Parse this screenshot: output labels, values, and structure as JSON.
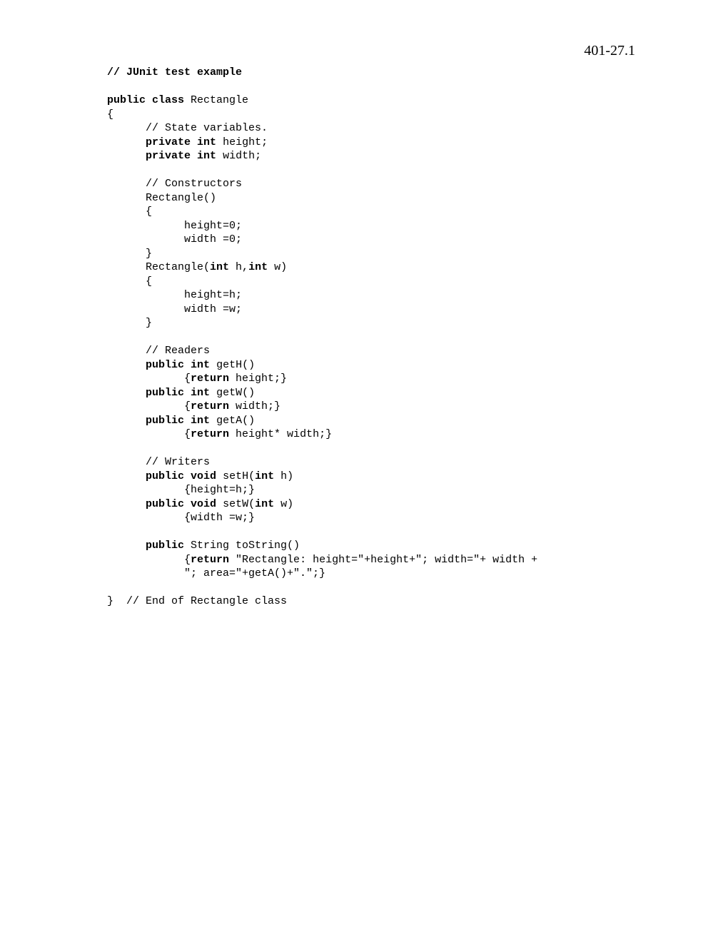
{
  "pageNumber": "401-27.1",
  "code": {
    "l1": "// JUnit test example",
    "l2a": "public",
    "l2b": "class",
    "l2c": " Rectangle",
    "l3": "{",
    "l4": "      // State variables.",
    "l5a": "private",
    "l5b": "int",
    "l5c": " height;",
    "l6a": "private",
    "l6b": "int",
    "l6c": " width;",
    "l7": "      // Constructors",
    "l8": "      Rectangle()",
    "l9": "      {",
    "l10": "            height=0;",
    "l11": "            width =0;",
    "l12": "      }",
    "l13a": "      Rectangle(",
    "l13b": "int",
    "l13c": " h,",
    "l13d": "int",
    "l13e": " w)",
    "l14": "      {",
    "l15": "            height=h;",
    "l16": "            width =w;",
    "l17": "      }",
    "l18": "      // Readers",
    "l19a": "public",
    "l19b": "int",
    "l19c": " getH()",
    "l20a": "            {",
    "l20b": "return",
    "l20c": " height;}",
    "l21a": "public",
    "l21b": "int",
    "l21c": " getW()",
    "l22a": "            {",
    "l22b": "return",
    "l22c": " width;}",
    "l23a": "public",
    "l23b": "int",
    "l23c": " getA()",
    "l24a": "            {",
    "l24b": "return",
    "l24c": " height* width;}",
    "l25": "      // Writers",
    "l26a": "public",
    "l26b": "void",
    "l26c": " setH(",
    "l26d": "int",
    "l26e": " h)",
    "l27": "            {height=h;}",
    "l28a": "public",
    "l28b": "void",
    "l28c": " setW(",
    "l28d": "int",
    "l28e": " w)",
    "l29": "            {width =w;}",
    "l30a": "public",
    "l30c": " String toString()",
    "l31a": "            {",
    "l31b": "return",
    "l31c": " \"Rectangle: height=\"+height+\"; width=\"+ width +",
    "l32": "            \"; area=\"+getA()+\".\";}",
    "l33": "}  // End of Rectangle class"
  }
}
